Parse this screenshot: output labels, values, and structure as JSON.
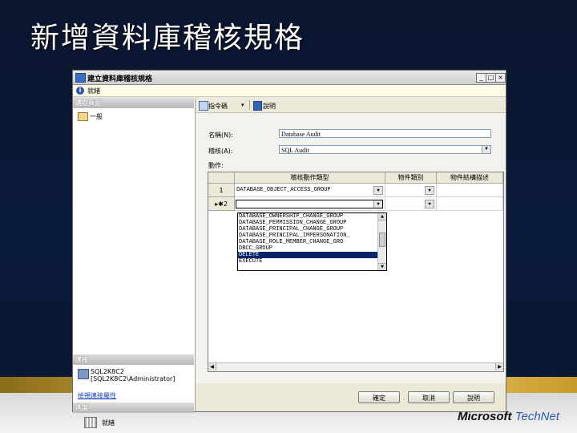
{
  "slide": {
    "title": "新增資料庫稽核規格"
  },
  "brand": {
    "microsoft": "Microsoft",
    "technet": "TechNet"
  },
  "dialog": {
    "title": "建立資料庫稽核規格",
    "status": "就緒",
    "window_buttons": {
      "minimize": "_",
      "maximize": "□",
      "close": "×"
    }
  },
  "left_panel": {
    "select_page_header": "選取頁面",
    "pages": [
      "一般"
    ],
    "connection_header": "連接",
    "server": "SQL2K8C2",
    "login": "[SQL2K8C2\\Administrator]",
    "view_connection_link": "檢視連接屬性",
    "progress_header": "進度",
    "progress_status": "就緒"
  },
  "toolbar": {
    "script_label": "指令碼",
    "script_arrow": "▾",
    "help_label": "說明"
  },
  "form": {
    "name_label": "名稱(N):",
    "name_value": "Database Audit",
    "audit_label": "稽核(A):",
    "audit_value": "SQL Audit",
    "actions_label": "動作:"
  },
  "grid": {
    "headers": [
      "稽核動作類型",
      "物件類別",
      "物件結構描述"
    ],
    "rows": [
      {
        "row_label": "1",
        "action_type": "DATABASE_OBJECT_ACCESS_GROUP"
      },
      {
        "row_label": "▸✱2",
        "action_type": ""
      }
    ],
    "dropdown_options": [
      "DATABASE_OWNERSHIP_CHANGE_GROUP",
      "DATABASE_PERMISSION_CHANGE_GROUP",
      "DATABASE_PRINCIPAL_CHANGE_GROUP",
      "DATABASE_PRINCIPAL_IMPERSONATION_",
      "DATABASE_ROLE_MEMBER_CHANGE_GRO",
      "DBCC_GROUP",
      "DELETE",
      "EXECUTE"
    ],
    "selected_option": "DELETE"
  },
  "buttons": {
    "ok": "確定",
    "cancel": "取消",
    "help": "說明"
  },
  "colors": {
    "selection": "#0a246a",
    "link": "#1a3fbd",
    "band_gold": "#d9b64a"
  }
}
